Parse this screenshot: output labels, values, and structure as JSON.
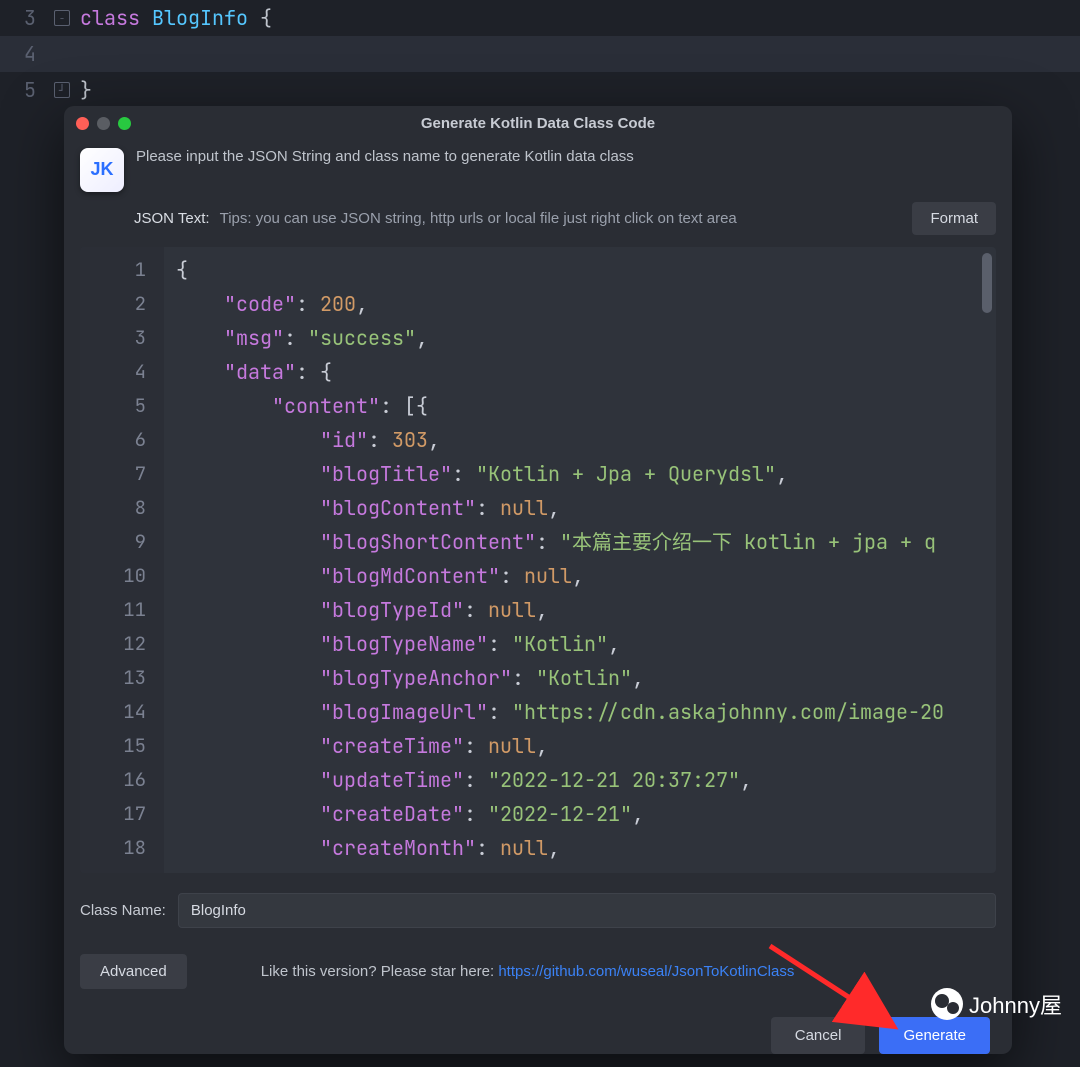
{
  "background_editor": {
    "lines": [
      {
        "num": "3",
        "kw": "class",
        "cls": "BlogInfo",
        "brace": "{"
      },
      {
        "num": "4"
      },
      {
        "num": "5",
        "brace": "}"
      }
    ]
  },
  "dialog": {
    "title": "Generate Kotlin Data Class Code",
    "app_icon_text": "JK",
    "instruction": "Please input the JSON String and class name to generate Kotlin data class",
    "json_text_label": "JSON Text:",
    "json_text_tips": "Tips: you can use JSON string, http urls or local file just right click on text area",
    "format_button": "Format",
    "classname_label": "Class Name:",
    "classname_value": "BlogInfo",
    "advanced_button": "Advanced",
    "star_text": "Like this version? Please star here: ",
    "star_link": "https://github.com/wuseal/JsonToKotlinClass",
    "cancel_button": "Cancel",
    "generate_button": "Generate"
  },
  "json_lines": [
    {
      "n": "1",
      "tokens": [
        {
          "t": "punc",
          "v": "{"
        }
      ]
    },
    {
      "n": "2",
      "tokens": [
        {
          "t": "sp",
          "v": "    "
        },
        {
          "t": "key",
          "v": "\"code\""
        },
        {
          "t": "punc",
          "v": ": "
        },
        {
          "t": "num",
          "v": "200"
        },
        {
          "t": "punc",
          "v": ","
        }
      ]
    },
    {
      "n": "3",
      "tokens": [
        {
          "t": "sp",
          "v": "    "
        },
        {
          "t": "key",
          "v": "\"msg\""
        },
        {
          "t": "punc",
          "v": ": "
        },
        {
          "t": "str",
          "v": "\"success\""
        },
        {
          "t": "punc",
          "v": ","
        }
      ]
    },
    {
      "n": "4",
      "tokens": [
        {
          "t": "sp",
          "v": "    "
        },
        {
          "t": "key",
          "v": "\"data\""
        },
        {
          "t": "punc",
          "v": ": {"
        }
      ]
    },
    {
      "n": "5",
      "tokens": [
        {
          "t": "sp",
          "v": "        "
        },
        {
          "t": "key",
          "v": "\"content\""
        },
        {
          "t": "punc",
          "v": ": [{"
        }
      ]
    },
    {
      "n": "6",
      "tokens": [
        {
          "t": "sp",
          "v": "            "
        },
        {
          "t": "key",
          "v": "\"id\""
        },
        {
          "t": "punc",
          "v": ": "
        },
        {
          "t": "num",
          "v": "303"
        },
        {
          "t": "punc",
          "v": ","
        }
      ]
    },
    {
      "n": "7",
      "tokens": [
        {
          "t": "sp",
          "v": "            "
        },
        {
          "t": "key",
          "v": "\"blogTitle\""
        },
        {
          "t": "punc",
          "v": ": "
        },
        {
          "t": "str",
          "v": "\"Kotlin + Jpa + Querydsl\""
        },
        {
          "t": "punc",
          "v": ","
        }
      ]
    },
    {
      "n": "8",
      "tokens": [
        {
          "t": "sp",
          "v": "            "
        },
        {
          "t": "key",
          "v": "\"blogContent\""
        },
        {
          "t": "punc",
          "v": ": "
        },
        {
          "t": "nul",
          "v": "null"
        },
        {
          "t": "punc",
          "v": ","
        }
      ]
    },
    {
      "n": "9",
      "tokens": [
        {
          "t": "sp",
          "v": "            "
        },
        {
          "t": "key",
          "v": "\"blogShortContent\""
        },
        {
          "t": "punc",
          "v": ": "
        },
        {
          "t": "str",
          "v": "\"本篇主要介绍一下 kotlin + jpa + q"
        }
      ]
    },
    {
      "n": "10",
      "tokens": [
        {
          "t": "sp",
          "v": "            "
        },
        {
          "t": "key",
          "v": "\"blogMdContent\""
        },
        {
          "t": "punc",
          "v": ": "
        },
        {
          "t": "nul",
          "v": "null"
        },
        {
          "t": "punc",
          "v": ","
        }
      ]
    },
    {
      "n": "11",
      "tokens": [
        {
          "t": "sp",
          "v": "            "
        },
        {
          "t": "key",
          "v": "\"blogTypeId\""
        },
        {
          "t": "punc",
          "v": ": "
        },
        {
          "t": "nul",
          "v": "null"
        },
        {
          "t": "punc",
          "v": ","
        }
      ]
    },
    {
      "n": "12",
      "tokens": [
        {
          "t": "sp",
          "v": "            "
        },
        {
          "t": "key",
          "v": "\"blogTypeName\""
        },
        {
          "t": "punc",
          "v": ": "
        },
        {
          "t": "str",
          "v": "\"Kotlin\""
        },
        {
          "t": "punc",
          "v": ","
        }
      ]
    },
    {
      "n": "13",
      "tokens": [
        {
          "t": "sp",
          "v": "            "
        },
        {
          "t": "key",
          "v": "\"blogTypeAnchor\""
        },
        {
          "t": "punc",
          "v": ": "
        },
        {
          "t": "str",
          "v": "\"Kotlin\""
        },
        {
          "t": "punc",
          "v": ","
        }
      ]
    },
    {
      "n": "14",
      "tokens": [
        {
          "t": "sp",
          "v": "            "
        },
        {
          "t": "key",
          "v": "\"blogImageUrl\""
        },
        {
          "t": "punc",
          "v": ": "
        },
        {
          "t": "str",
          "v": "\"https://cdn.askajohnny.com/image-20"
        }
      ]
    },
    {
      "n": "15",
      "tokens": [
        {
          "t": "sp",
          "v": "            "
        },
        {
          "t": "key",
          "v": "\"createTime\""
        },
        {
          "t": "punc",
          "v": ": "
        },
        {
          "t": "nul",
          "v": "null"
        },
        {
          "t": "punc",
          "v": ","
        }
      ]
    },
    {
      "n": "16",
      "tokens": [
        {
          "t": "sp",
          "v": "            "
        },
        {
          "t": "key",
          "v": "\"updateTime\""
        },
        {
          "t": "punc",
          "v": ": "
        },
        {
          "t": "str",
          "v": "\"2022-12-21 20:37:27\""
        },
        {
          "t": "punc",
          "v": ","
        }
      ]
    },
    {
      "n": "17",
      "tokens": [
        {
          "t": "sp",
          "v": "            "
        },
        {
          "t": "key",
          "v": "\"createDate\""
        },
        {
          "t": "punc",
          "v": ": "
        },
        {
          "t": "str",
          "v": "\"2022-12-21\""
        },
        {
          "t": "punc",
          "v": ","
        }
      ]
    },
    {
      "n": "18",
      "tokens": [
        {
          "t": "sp",
          "v": "            "
        },
        {
          "t": "key",
          "v": "\"createMonth\""
        },
        {
          "t": "punc",
          "v": ": "
        },
        {
          "t": "nul",
          "v": "null"
        },
        {
          "t": "punc",
          "v": ","
        }
      ]
    }
  ],
  "watermark": "Johnny屋"
}
